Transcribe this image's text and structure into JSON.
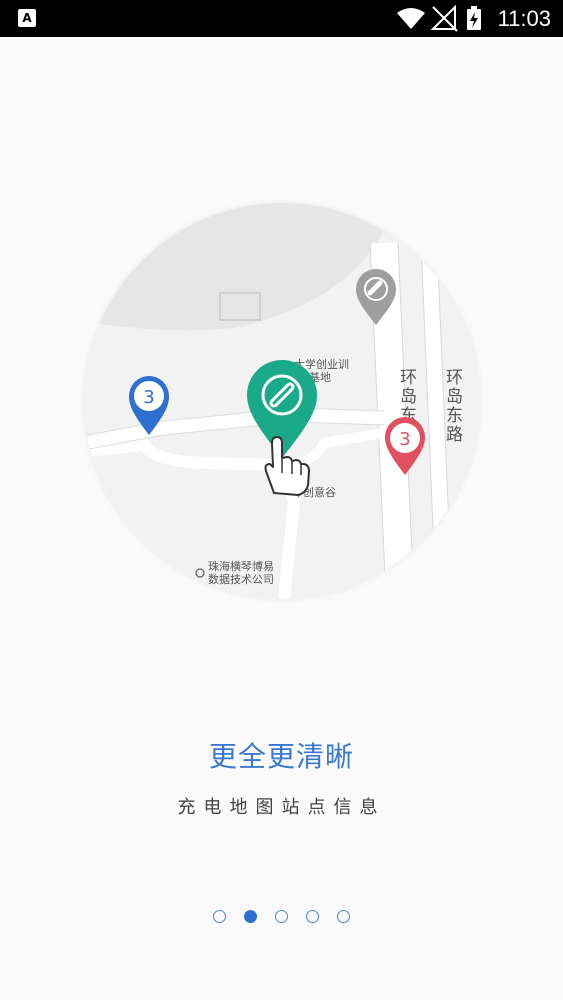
{
  "status_bar": {
    "app_badge": "A",
    "time": "11:03"
  },
  "map": {
    "labels": {
      "university": "大学创业训",
      "university_2": "琴基地",
      "road_east_1": "环岛东路",
      "road_east_2": "环岛东路",
      "valley": "琴创意谷",
      "company_1": "珠海横琴博易",
      "company_2": "数据技术公司"
    },
    "markers": {
      "blue_count": "3",
      "red_count": "3"
    },
    "colors": {
      "green": "#1aaa8a",
      "blue": "#2e6fd0",
      "red": "#e0505e",
      "gray": "#9e9e9e"
    }
  },
  "onboarding": {
    "title": "更全更清晰",
    "subtitle": "充电地图站点信息",
    "page_count": 5,
    "active_page": 2
  }
}
